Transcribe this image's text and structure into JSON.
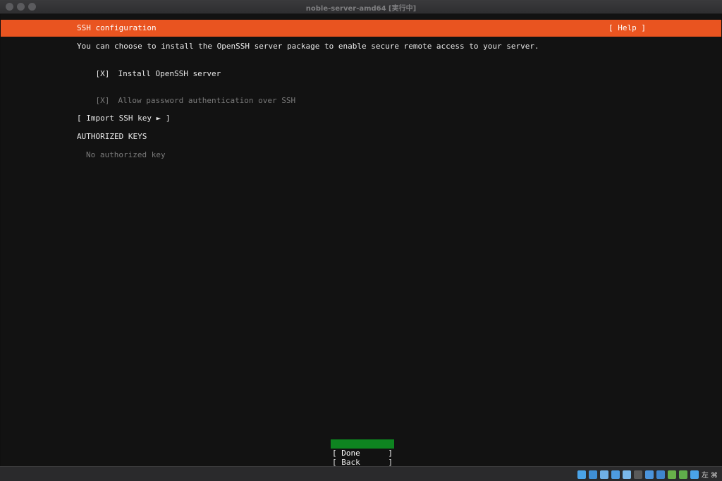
{
  "window": {
    "title": "noble-server-amd64 [実行中]"
  },
  "header": {
    "title": "SSH configuration",
    "help": "[ Help ]"
  },
  "intro": "You can choose to install the OpenSSH server package to enable secure remote access to your server.",
  "options": {
    "install": {
      "mark": "[X]",
      "label": "Install OpenSSH server"
    },
    "password": {
      "mark": "[X]",
      "label": "Allow password authentication over SSH"
    }
  },
  "import_key": "[ Import SSH key ► ]",
  "authorized": {
    "heading": "AUTHORIZED KEYS",
    "empty": "No authorized key"
  },
  "buttons": {
    "done": "Done",
    "back": "Back",
    "open": "[",
    "close": "]"
  },
  "statusbar": {
    "host_key": "左 ⌘",
    "icons": [
      "hard-disk-icon",
      "optical-drive-icon",
      "audio-icon",
      "network-icon",
      "usb-icon",
      "shared-folder-icon",
      "display-icon",
      "video-capture-icon",
      "recording-icon",
      "cpu-icon",
      "mouse-integration-icon"
    ],
    "colors": [
      "#4aa3e8",
      "#3f8fd6",
      "#6fb0e6",
      "#4d9be0",
      "#7ab8ea",
      "#5a5a5a",
      "#4b94dc",
      "#3f86cf",
      "#68b04a",
      "#5fae4b",
      "#4aa3e8"
    ]
  }
}
